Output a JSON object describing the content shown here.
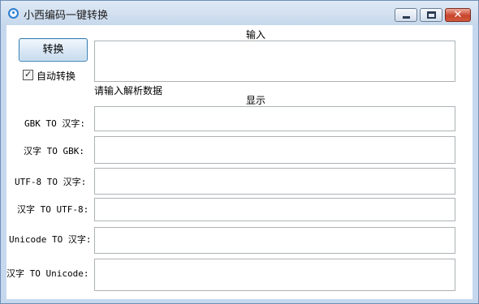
{
  "window": {
    "title": "小西编码一键转换",
    "controls": {
      "minimize": "minimize",
      "maximize": "maximize",
      "close": "✕"
    }
  },
  "toolbar": {
    "convert_label": "转换",
    "auto_convert_label": "自动转换",
    "auto_convert_checked": true
  },
  "input_section": {
    "header": "输入",
    "value": "",
    "hint": "请输入解析数据"
  },
  "output_section": {
    "header": "显示",
    "rows": [
      {
        "label": "GBK TO 汉字:",
        "value": ""
      },
      {
        "label": "汉字 TO GBK:",
        "value": ""
      },
      {
        "label": "UTF-8 TO 汉字:",
        "value": ""
      },
      {
        "label": "汉字 TO UTF-8:",
        "value": ""
      },
      {
        "label": "Unicode TO 汉字:",
        "value": ""
      },
      {
        "label": "汉字 TO Unicode:",
        "value": ""
      }
    ]
  }
}
